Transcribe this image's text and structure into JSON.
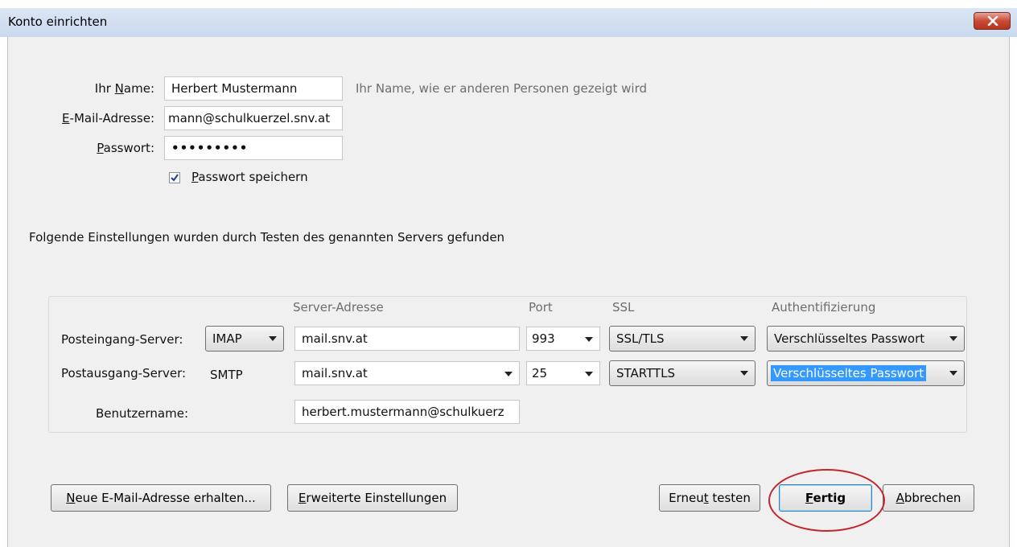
{
  "window": {
    "title": "Konto einrichten"
  },
  "identity": {
    "name_label_pre": "Ihr ",
    "name_label_ul": "N",
    "name_label_post": "ame:",
    "name_value": "Herbert Mustermann",
    "name_hint": "Ihr Name, wie er anderen Personen gezeigt wird",
    "email_label_ul": "E",
    "email_label_post": "-Mail-Adresse:",
    "email_value": "mann@schulkuerzel.snv.at",
    "password_label_ul": "P",
    "password_label_post": "asswort:",
    "password_value": "•••••••••",
    "remember_ul": "P",
    "remember_post": "asswort speichern",
    "remember_checked": true
  },
  "found_message": "Folgende Einstellungen wurden durch Testen des genannten Servers gefunden",
  "server_table": {
    "headers": {
      "address": "Server-Adresse",
      "port": "Port",
      "ssl": "SSL",
      "auth": "Authentifizierung"
    },
    "incoming": {
      "label": "Posteingang-Server:",
      "protocol": "IMAP",
      "address": "mail.snv.at",
      "port": "993",
      "ssl": "SSL/TLS",
      "auth": "Verschlüsseltes Passwort"
    },
    "outgoing": {
      "label": "Postausgang-Server:",
      "protocol": "SMTP",
      "address": "mail.snv.at",
      "port": "25",
      "ssl": "STARTTLS",
      "auth": "Verschlüsseltes Passwort"
    },
    "username": {
      "label": "Benutzername:",
      "value": "herbert.mustermann@schulkuerz"
    }
  },
  "buttons": {
    "new_email_ul": "N",
    "new_email_post": "eue E-Mail-Adresse erhalten...",
    "advanced_ul": "E",
    "advanced_post": "rweiterte Einstellungen",
    "retest_pre": "Erneu",
    "retest_ul": "t",
    "retest_post": " testen",
    "done_ul": "F",
    "done_post": "ertig",
    "cancel_ul": "A",
    "cancel_post": "bbrechen"
  },
  "colors": {
    "highlight": "#3399ff",
    "annotation_ring": "#c0262c"
  }
}
